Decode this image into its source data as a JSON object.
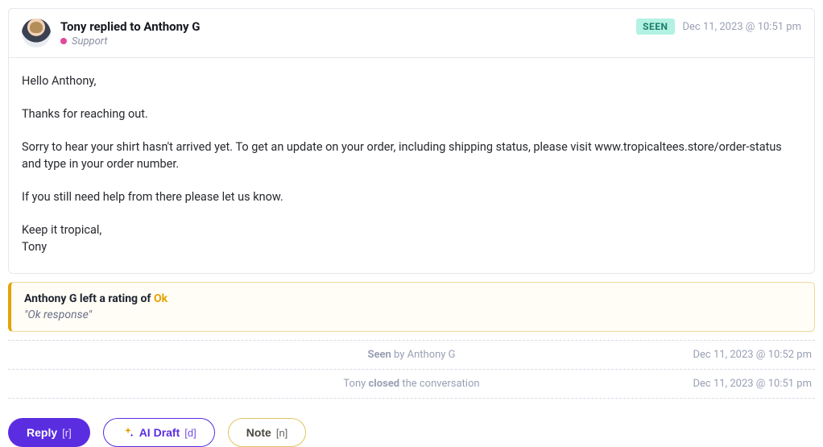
{
  "message": {
    "author": "Tony",
    "action_verb": "replied to",
    "recipient": "Anthony G",
    "channel": "Support",
    "status_badge": "SEEN",
    "timestamp": "Dec 11, 2023 @ 10:51 pm",
    "body": {
      "p1": "Hello Anthony,",
      "p2": "Thanks for reaching out.",
      "p3": "Sorry to hear your shirt hasn't arrived yet. To get an update on your order, including shipping status, please visit www.tropicaltees.store/order-status and type in your order number.",
      "p4": "If you still need help from there please let us know.",
      "p5": "Keep it tropical,\nTony"
    }
  },
  "rating": {
    "prefix": "Anthony G left a rating of ",
    "value": "Ok",
    "quote": "\"Ok response\""
  },
  "events": {
    "seen": {
      "prefix": "Seen ",
      "by": "by Anthony G",
      "timestamp": "Dec 11, 2023 @ 10:52 pm"
    },
    "closed": {
      "actor": "Tony ",
      "verb": "closed",
      "suffix": " the conversation",
      "timestamp": "Dec 11, 2023 @ 10:51 pm"
    }
  },
  "actions": {
    "reply": {
      "label": "Reply",
      "shortcut": "[r]"
    },
    "ai_draft": {
      "label": "AI Draft",
      "shortcut": "[d]"
    },
    "note": {
      "label": "Note",
      "shortcut": "[n]"
    }
  }
}
